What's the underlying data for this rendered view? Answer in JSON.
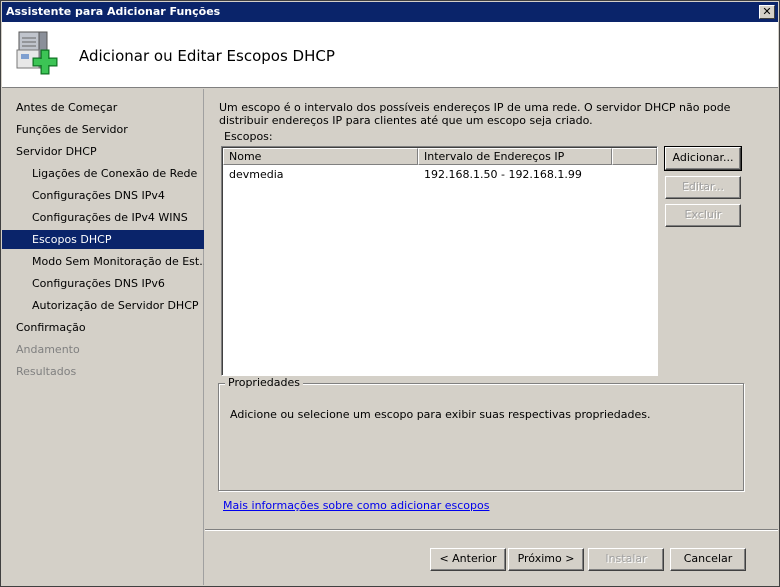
{
  "window": {
    "title": "Assistente para Adicionar Funções",
    "close_glyph": "✕"
  },
  "header": {
    "title": "Adicionar ou Editar Escopos DHCP",
    "icon": "server-add-icon"
  },
  "nav": {
    "items": [
      {
        "label": "Antes de Começar",
        "level": 0,
        "state": "normal"
      },
      {
        "label": "Funções de Servidor",
        "level": 0,
        "state": "normal"
      },
      {
        "label": "Servidor DHCP",
        "level": 0,
        "state": "normal"
      },
      {
        "label": "Ligações de Conexão de Rede",
        "level": 1,
        "state": "normal"
      },
      {
        "label": "Configurações DNS IPv4",
        "level": 1,
        "state": "normal"
      },
      {
        "label": "Configurações de IPv4 WINS",
        "level": 1,
        "state": "normal"
      },
      {
        "label": "Escopos DHCP",
        "level": 1,
        "state": "selected"
      },
      {
        "label": "Modo Sem Monitoração de Est...",
        "level": 1,
        "state": "normal"
      },
      {
        "label": "Configurações DNS IPv6",
        "level": 1,
        "state": "normal"
      },
      {
        "label": "Autorização de Servidor DHCP",
        "level": 1,
        "state": "normal"
      },
      {
        "label": "Confirmação",
        "level": 0,
        "state": "normal"
      },
      {
        "label": "Andamento",
        "level": 0,
        "state": "disabled"
      },
      {
        "label": "Resultados",
        "level": 0,
        "state": "disabled"
      }
    ]
  },
  "main": {
    "description": "Um escopo é o intervalo dos possíveis endereços IP de uma rede. O servidor DHCP não pode distribuir endereços IP para clientes até que um escopo seja criado.",
    "scopes_label": "Escopos:",
    "columns": [
      "Nome",
      "Intervalo de Endereços IP",
      ""
    ],
    "rows": [
      {
        "name": "devmedia",
        "range": "192.168.1.50 - 192.168.1.99"
      }
    ],
    "buttons": {
      "add": "Adicionar...",
      "edit": "Editar...",
      "delete": "Excluir"
    },
    "properties": {
      "legend": "Propriedades",
      "text": "Adicione ou selecione um escopo para exibir suas respectivas propriedades."
    },
    "more_info_link": "Mais informações sobre como adicionar escopos"
  },
  "footer": {
    "back": "< Anterior",
    "next": "Próximo >",
    "install": "Instalar",
    "cancel": "Cancelar"
  }
}
